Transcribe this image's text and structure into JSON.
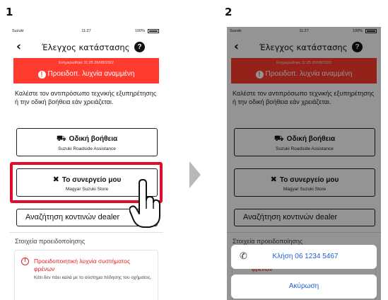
{
  "steps": [
    "1",
    "2"
  ],
  "status_bar": {
    "carrier": "Suzuki",
    "time": "11:27",
    "battery": "100%"
  },
  "header": {
    "back": "‹",
    "title": "Έλεγχος κατάστασης",
    "help": "?"
  },
  "alert": {
    "updated": "Ενημερώθηκε 11:25 26/08/2022",
    "icon": "!",
    "message": "Προειδοπ. λυχνία αναμμένη"
  },
  "intro": "Καλέστε τον αντιπρόσωπο τεχνικής εξυπηρέτησης ή την οδική βοήθεια εάν χρειάζεται.",
  "cards": {
    "roadside": {
      "icon": "tow-truck-icon",
      "glyph": "⛟",
      "title": "Οδική βοήθεια",
      "subtitle": "Suzuki Roadside Assistance"
    },
    "garage": {
      "icon": "tools-icon",
      "glyph": "✖",
      "title": "Το συνεργείο μου",
      "subtitle": "Magyar Suzuki Store"
    }
  },
  "search_button": "Αναζήτηση κοντινών dealer",
  "section_title": "Στοιχεία προειδοποίησης",
  "warning": {
    "icon": "!",
    "title": "Προειδοποιητική λυχνία συστήματος φρένων",
    "description": "Κάτι δεν πάει καλά με το σύστημα πέδησης του οχήματος."
  },
  "action_sheet": {
    "call": "Κλήση 06 1234 5467",
    "call_icon": "✆",
    "cancel": "Ακύρωση"
  },
  "colors": {
    "alert_red": "#ff3b2f",
    "highlight_red": "#e10c2c",
    "link_blue": "#1f5fd6"
  }
}
